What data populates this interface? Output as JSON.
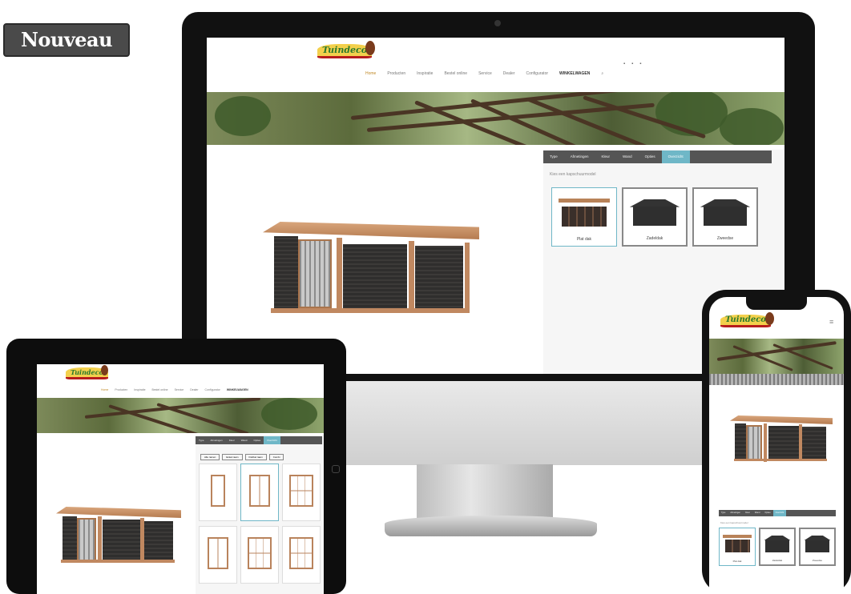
{
  "badge": {
    "label": "Nouveau"
  },
  "site": {
    "logo_text": "Tuindeco",
    "nav": [
      "Home",
      "Producten",
      "Inspiratie",
      "Bestel online",
      "Service",
      "Dealer",
      "Configurator"
    ],
    "nav_cta": "WINKELWAGEN",
    "tabs": [
      "Type",
      "Afmetingen",
      "Kleur",
      "Wand",
      "Opties",
      "Overzicht"
    ],
    "config_title": "Kies een kapschuurmodel",
    "options": [
      "Plat dak",
      "Zadeldak",
      "Zweedse"
    ]
  },
  "desktop": {
    "selected_option_index": 0
  },
  "tablet": {
    "filters": [
      "Alle ramen",
      "Enkel raam",
      "Dubbel raam",
      "Combi"
    ]
  },
  "phone": {
    "menu_icon": "hamburger-menu-icon"
  },
  "colors": {
    "accent": "#6fb7c7",
    "tab_bar": "#555555",
    "wood": "#c08860",
    "brand_green": "#2c7a2c"
  }
}
